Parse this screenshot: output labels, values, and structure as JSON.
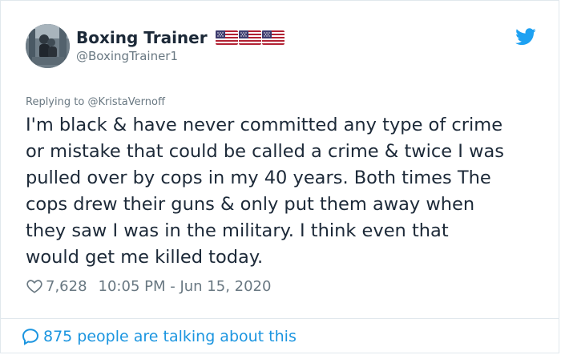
{
  "author": {
    "display_name": "Boxing Trainer",
    "handle": "@BoxingTrainer1",
    "flag_count_label": "3 US flags"
  },
  "reply": {
    "prefix": "Replying to",
    "handle": "@KristaVernoff"
  },
  "tweet": {
    "lines": [
      "I'm black & have never committed any type of crime",
      "or mistake that could be called a crime & twice I was",
      "pulled over by cops in my 40 years. Both times The",
      "cops drew their guns & only put them away when",
      "they saw I was in the military. I think even that",
      "would get me killed today."
    ]
  },
  "meta": {
    "like_count": "7,628",
    "timestamp": "10:05 PM - Jun 15, 2020"
  },
  "conversation": {
    "label": "875 people are talking about this"
  },
  "colors": {
    "twitter_blue": "#1da1f2",
    "link_blue": "#1b95e0",
    "text": "#1c2938",
    "muted": "#697882",
    "divider": "#e1e8ed"
  },
  "icons": {
    "brand": "twitter-bird-icon",
    "like": "heart-icon",
    "conversation": "chat-bubble-icon",
    "flag": "us-flag-icon"
  }
}
